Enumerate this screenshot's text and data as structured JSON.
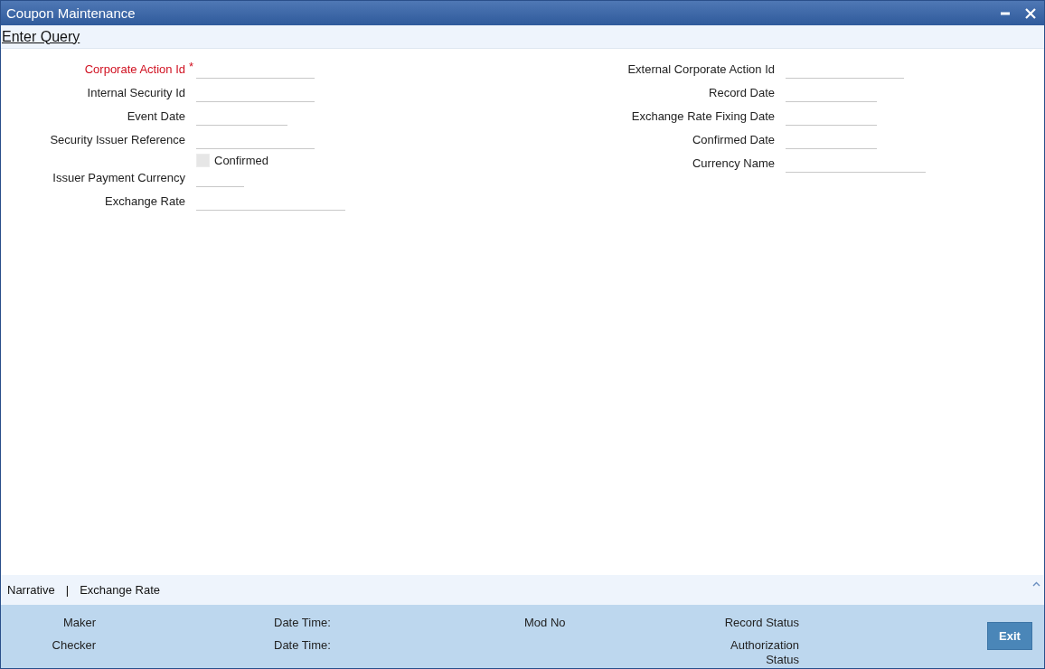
{
  "window": {
    "title": "Coupon Maintenance"
  },
  "toolbar": {
    "action": "Enter Query"
  },
  "form": {
    "required_marker": "*",
    "left": [
      {
        "kind": "text",
        "label": "Corporate Action Id",
        "required": true
      },
      {
        "kind": "text",
        "label": "Internal Security Id",
        "required": false
      },
      {
        "kind": "date",
        "label": "Event Date",
        "required": false
      },
      {
        "kind": "text",
        "label": "Security Issuer Reference",
        "required": false
      },
      {
        "kind": "checkbox",
        "label": "Confirmed",
        "checked": false
      },
      {
        "kind": "currency",
        "label": "Issuer Payment Currency",
        "required": false
      },
      {
        "kind": "rate",
        "label": "Exchange Rate",
        "required": false
      }
    ],
    "right": [
      {
        "kind": "text",
        "label": "External Corporate Action Id",
        "required": false
      },
      {
        "kind": "date",
        "label": "Record Date",
        "required": false
      },
      {
        "kind": "date",
        "label": "Exchange Rate Fixing Date",
        "required": false
      },
      {
        "kind": "date",
        "label": "Confirmed Date",
        "required": false
      },
      {
        "kind": "name",
        "label": "Currency Name",
        "required": false
      }
    ]
  },
  "subtabs": {
    "items": [
      "Narrative",
      "Exchange Rate"
    ],
    "separator": "|"
  },
  "footer": {
    "columns": [
      {
        "labels": [
          "Maker",
          "Checker"
        ]
      },
      {
        "labels": [
          "Date Time:",
          "Date Time:"
        ]
      },
      {
        "labels": [
          "Mod No"
        ]
      },
      {
        "labels": [
          "Record Status",
          "Authorization Status"
        ]
      }
    ],
    "button": "Exit"
  }
}
